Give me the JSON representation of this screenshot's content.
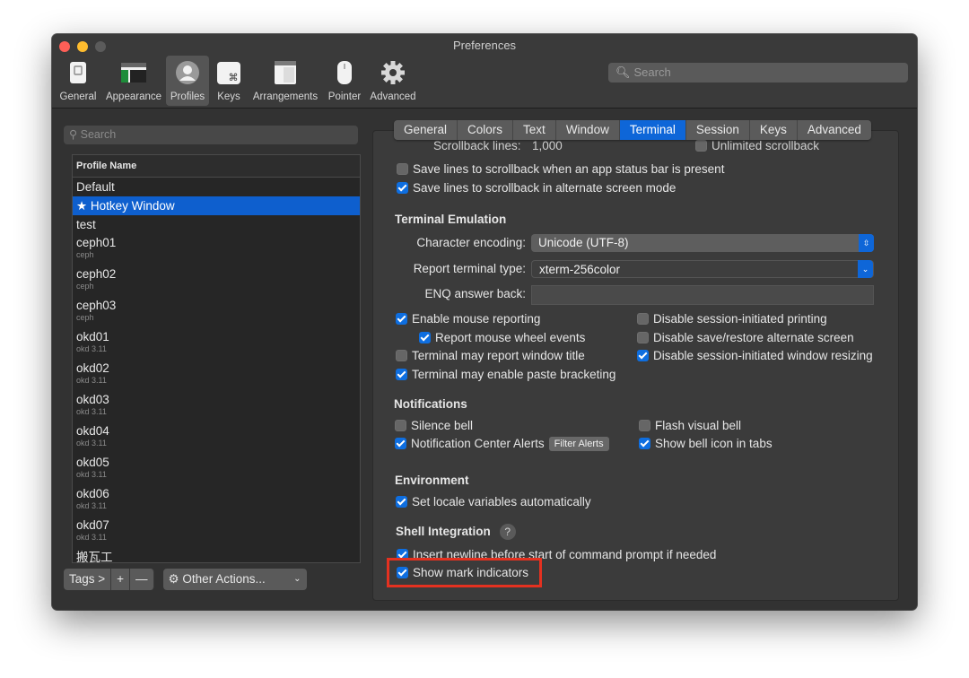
{
  "window": {
    "title": "Preferences"
  },
  "toolbar": {
    "items": [
      {
        "label": "General",
        "icon": "general-switch-icon"
      },
      {
        "label": "Appearance",
        "icon": "appearance-window-icon"
      },
      {
        "label": "Profiles",
        "icon": "profiles-person-icon",
        "selected": true
      },
      {
        "label": "Keys",
        "icon": "keys-command-icon"
      },
      {
        "label": "Arrangements",
        "icon": "arrangements-window-icon"
      },
      {
        "label": "Pointer",
        "icon": "pointer-mouse-icon"
      },
      {
        "label": "Advanced",
        "icon": "advanced-gear-icon"
      }
    ],
    "search_placeholder": "Search"
  },
  "profiles": {
    "search_placeholder": "Search",
    "header": "Profile Name",
    "items": [
      {
        "name": "Default",
        "tag": ""
      },
      {
        "name": "★ Hotkey Window",
        "tag": "",
        "selected": true
      },
      {
        "name": "test",
        "tag": ""
      },
      {
        "name": "ceph01",
        "tag": "ceph"
      },
      {
        "name": "ceph02",
        "tag": "ceph"
      },
      {
        "name": "ceph03",
        "tag": "ceph"
      },
      {
        "name": "okd01",
        "tag": "okd 3.11"
      },
      {
        "name": "okd02",
        "tag": "okd 3.11"
      },
      {
        "name": "okd03",
        "tag": "okd 3.11"
      },
      {
        "name": "okd04",
        "tag": "okd 3.11"
      },
      {
        "name": "okd05",
        "tag": "okd 3.11"
      },
      {
        "name": "okd06",
        "tag": "okd 3.11"
      },
      {
        "name": "okd07",
        "tag": "okd 3.11"
      },
      {
        "name": "搬瓦工",
        "tag": ""
      }
    ],
    "buttons": {
      "tags": "Tags >",
      "add": "+",
      "remove": "—",
      "actions": "Other Actions..."
    }
  },
  "tabs": [
    {
      "label": "General"
    },
    {
      "label": "Colors"
    },
    {
      "label": "Text"
    },
    {
      "label": "Window"
    },
    {
      "label": "Terminal",
      "selected": true
    },
    {
      "label": "Session"
    },
    {
      "label": "Keys"
    },
    {
      "label": "Advanced"
    }
  ],
  "terminal": {
    "scrollback_label": "Scrollback lines:",
    "scrollback_value": "1,000",
    "unlimited": "Unlimited scrollback",
    "save_status_bar": {
      "label": "Save lines to scrollback when an app status bar is present",
      "checked": false
    },
    "save_alt_screen": {
      "label": "Save lines to scrollback in alternate screen mode",
      "checked": true
    },
    "emulation_title": "Terminal Emulation",
    "char_encoding_label": "Character encoding:",
    "char_encoding_value": "Unicode (UTF-8)",
    "report_type_label": "Report terminal type:",
    "report_type_value": "xterm-256color",
    "enq_label": "ENQ answer back:",
    "enable_mouse": {
      "label": "Enable mouse reporting",
      "checked": true
    },
    "report_wheel": {
      "label": "Report mouse wheel events",
      "checked": true
    },
    "report_title": {
      "label": "Terminal may report window title",
      "checked": false
    },
    "paste_bracketing": {
      "label": "Terminal may enable paste bracketing",
      "checked": true
    },
    "disable_printing": {
      "label": "Disable session-initiated printing",
      "checked": false
    },
    "disable_altscreen": {
      "label": "Disable save/restore alternate screen",
      "checked": false
    },
    "disable_resizing": {
      "label": "Disable session-initiated window resizing",
      "checked": true
    },
    "notifications_title": "Notifications",
    "silence_bell": {
      "label": "Silence bell",
      "checked": false
    },
    "flash_bell": {
      "label": "Flash visual bell",
      "checked": false
    },
    "nc_alerts": {
      "label": "Notification Center Alerts",
      "checked": true
    },
    "filter_alerts": "Filter Alerts",
    "bell_icon": {
      "label": "Show bell icon in tabs",
      "checked": true
    },
    "environment_title": "Environment",
    "set_locale": {
      "label": "Set locale variables automatically",
      "checked": true
    },
    "shell_title": "Shell Integration",
    "help": "?",
    "insert_newline": {
      "label": "Insert newline before start of command prompt if needed",
      "checked": true
    },
    "show_marks": {
      "label": "Show mark indicators",
      "checked": true
    }
  },
  "colors": {
    "accent": "#0e66d8",
    "highlight": "#e43120",
    "window_bg": "#323232"
  }
}
